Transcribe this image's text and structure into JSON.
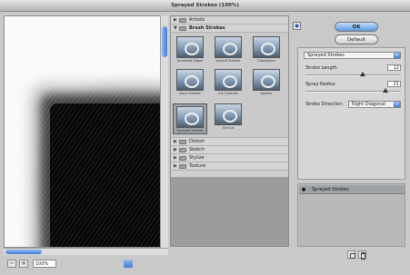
{
  "window": {
    "title": "Sprayed Strokes (100%)"
  },
  "preview": {
    "zoom_value": "100%"
  },
  "gallery": {
    "folders_top": [
      {
        "label": "Artistic",
        "expanded": false
      }
    ],
    "brush_strokes": {
      "label": "Brush Strokes",
      "expanded": true,
      "filters": [
        {
          "label": "Accented Edges"
        },
        {
          "label": "Angled Strokes"
        },
        {
          "label": "Crosshatch"
        },
        {
          "label": "Dark Strokes"
        },
        {
          "label": "Ink Outlines"
        },
        {
          "label": "Spatter"
        },
        {
          "label": "Sprayed Strokes",
          "selected": true
        },
        {
          "label": "Sumi-e"
        }
      ]
    },
    "folders_bottom": [
      {
        "label": "Distort"
      },
      {
        "label": "Sketch"
      },
      {
        "label": "Stylize"
      },
      {
        "label": "Texture"
      }
    ]
  },
  "buttons": {
    "ok": "OK",
    "default": "Default"
  },
  "settings": {
    "filter": "Sprayed Strokes",
    "stroke_length_label": "Stroke Length",
    "stroke_length": "12",
    "stroke_length_fraction": 0.6,
    "spray_radius_label": "Spray Radius",
    "spray_radius": "21",
    "spray_radius_fraction": 0.84,
    "direction_label": "Stroke Direction:",
    "direction": "Right Diagonal"
  },
  "layers": {
    "active": "Sprayed Strokes"
  },
  "colors": {
    "accent": "#3f7bd6",
    "window_bg": "#c9c9c9"
  },
  "icons": [
    "eye-icon",
    "new-effect-layer-icon",
    "delete-effect-layer-icon",
    "collapse-icon",
    "folder-icon"
  ]
}
